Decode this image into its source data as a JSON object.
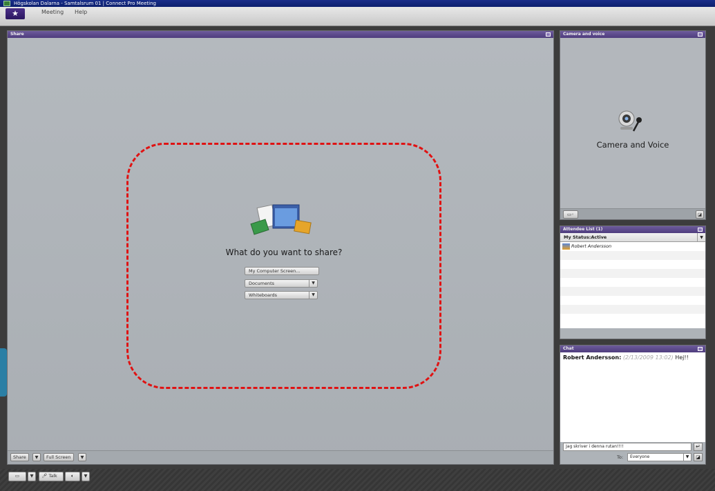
{
  "window": {
    "title": "Högskolan Dalarna - Samtalsrum 01 | Connect Pro Meeting"
  },
  "menu": {
    "items": [
      "Meeting",
      "Help"
    ]
  },
  "share_pod": {
    "title": "Share",
    "question": "What do you want to share?",
    "buttons": {
      "screen": "My Computer Screen...",
      "documents": "Documents",
      "whiteboards": "Whiteboards"
    },
    "footer": {
      "share": "Share",
      "fullscreen": "Full Screen"
    }
  },
  "camera_pod": {
    "title": "Camera and voice",
    "label": "Camera and Voice"
  },
  "attendee_pod": {
    "title": "Attendee List (1)",
    "status": "My Status:Active",
    "attendees": [
      "Robert Andersson"
    ]
  },
  "chat_pod": {
    "title": "Chat",
    "messages": [
      {
        "name": "Robert Andersson:",
        "stamp": "(2/13/2009 13:02)",
        "text": "Hej!!"
      }
    ],
    "input_value": "Jag skriver i denna rutan!!!!",
    "to_label": "To:",
    "to_value": "Everyone"
  },
  "bottom_bar": {
    "talk": "Talk"
  },
  "colors": {
    "pod_header": "#5a4890",
    "annotation": "#e01212"
  }
}
